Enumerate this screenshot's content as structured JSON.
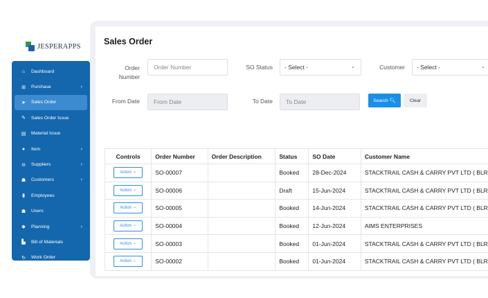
{
  "logo": {
    "text": "JESPERAPPS"
  },
  "sidebar": {
    "items": [
      {
        "label": "Dashboard",
        "icon": "home-icon",
        "glyph": "⌂",
        "chevron": false
      },
      {
        "label": "Purchase",
        "icon": "cart-icon",
        "glyph": "⊞",
        "chevron": true
      },
      {
        "label": "Sales Order",
        "icon": "send-icon",
        "glyph": "➤",
        "chevron": false,
        "active": true
      },
      {
        "label": "Sales Order Issue",
        "icon": "edit-icon",
        "glyph": "✎",
        "chevron": false
      },
      {
        "label": "Material Issue",
        "icon": "document-icon",
        "glyph": "▤",
        "chevron": false
      },
      {
        "label": "Item",
        "icon": "tag-icon",
        "glyph": "●",
        "chevron": true
      },
      {
        "label": "Suppliers",
        "icon": "supplier-icon",
        "glyph": "⊖",
        "chevron": true
      },
      {
        "label": "Customers",
        "icon": "customers-icon",
        "glyph": "☗",
        "chevron": true
      },
      {
        "label": "Employees",
        "icon": "id-card-icon",
        "glyph": "▮",
        "chevron": false
      },
      {
        "label": "Users",
        "icon": "user-icon",
        "glyph": "☗",
        "chevron": false
      },
      {
        "label": "Planning",
        "icon": "planning-icon",
        "glyph": "◆",
        "chevron": true
      },
      {
        "label": "Bill of Materials",
        "icon": "chart-icon",
        "glyph": "▙",
        "chevron": false
      },
      {
        "label": "Work Order",
        "icon": "refresh-icon",
        "glyph": "↻",
        "chevron": false
      }
    ]
  },
  "page": {
    "title": "Sales Order"
  },
  "filters": {
    "order_number_label": "Order Number",
    "order_number_placeholder": "Order Number",
    "so_status_label": "SO Status",
    "so_status_value": "- Select -",
    "customer_label": "Customer",
    "customer_value": "- Select -",
    "from_date_label": "From Date",
    "from_date_placeholder": "From Date",
    "to_date_label": "To Date",
    "to_date_placeholder": "To Date",
    "search_label": "Search",
    "clear_label": "Clear"
  },
  "table": {
    "columns": [
      "Controls",
      "Order Number",
      "Order Description",
      "Status",
      "SO Date",
      "Customer Name"
    ],
    "action_label": "Action",
    "rows": [
      {
        "order_number": "SO-00007",
        "description": "",
        "status": "Booked",
        "so_date": "28-Dec-2024",
        "customer": "STACKTRAIL CASH & CARRY PVT LTD ( BLR )"
      },
      {
        "order_number": "SO-00006",
        "description": "",
        "status": "Draft",
        "so_date": "15-Jun-2024",
        "customer": "STACKTRAIL CASH & CARRY PVT LTD ( BLR )"
      },
      {
        "order_number": "SO-00005",
        "description": "",
        "status": "Booked",
        "so_date": "14-Jun-2024",
        "customer": "STACKTRAIL CASH & CARRY PVT LTD ( BLR )"
      },
      {
        "order_number": "SO-00004",
        "description": "",
        "status": "Booked",
        "so_date": "12-Jun-2024",
        "customer": "AIMS ENTERPRISES"
      },
      {
        "order_number": "SO-00003",
        "description": "",
        "status": "Booked",
        "so_date": "01-Jun-2024",
        "customer": "STACKTRAIL CASH & CARRY PVT LTD ( BLR )"
      },
      {
        "order_number": "SO-00002",
        "description": "",
        "status": "Booked",
        "so_date": "01-Jun-2024",
        "customer": "STACKTRAIL CASH & CARRY PVT LTD ( BLR )"
      }
    ]
  },
  "colors": {
    "sidebar": "#1467ad",
    "active_item": "#3c8bd0",
    "primary_button": "#1a8fe8",
    "panel_bg": "#eef0f4"
  }
}
